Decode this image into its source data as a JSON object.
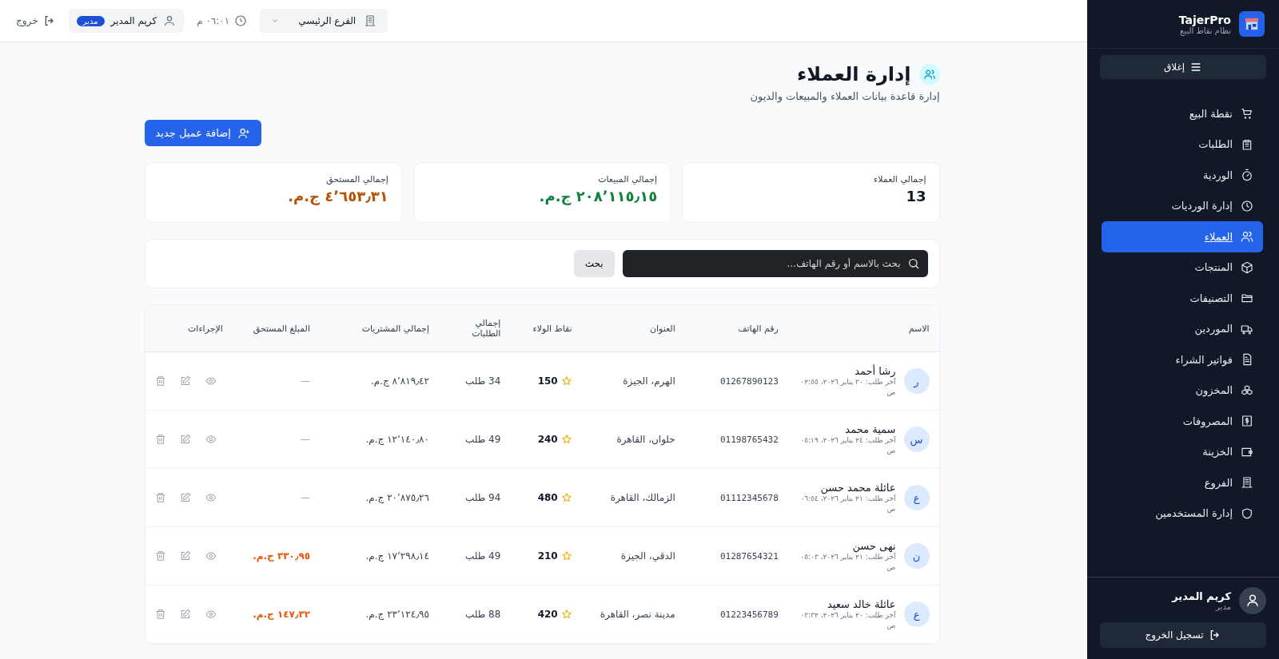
{
  "topbar": {
    "logout": "خروج",
    "user": {
      "name": "كريم المدير",
      "role": "مدير"
    },
    "time": "٠٦:٠١ م",
    "branch": "الفرع الرئيسي"
  },
  "sidebar": {
    "brand": "TajerPro",
    "tagline": "نظام نقاط البيع",
    "toggle": "إغلاق",
    "items": [
      {
        "label": "نقطة البيع",
        "selected": false
      },
      {
        "label": "الطلبات",
        "selected": false
      },
      {
        "label": "الوردية",
        "selected": false
      },
      {
        "label": "إدارة الورديات",
        "selected": false
      },
      {
        "label": "العملاء",
        "selected": true
      },
      {
        "label": "المنتجات",
        "selected": false
      },
      {
        "label": "التصنيفات",
        "selected": false
      },
      {
        "label": "الموردين",
        "selected": false
      },
      {
        "label": "فواتير الشراء",
        "selected": false
      },
      {
        "label": "المخزون",
        "selected": false
      },
      {
        "label": "المصروفات",
        "selected": false
      },
      {
        "label": "الخزينة",
        "selected": false
      },
      {
        "label": "الفروع",
        "selected": false
      },
      {
        "label": "إدارة المستخدمين",
        "selected": false
      }
    ],
    "user": {
      "name": "كريم المدير",
      "role": "مدير"
    },
    "signout": "تسجيل الخروج"
  },
  "page": {
    "title": "إدارة العملاء",
    "subtitle": "إدارة قاعدة بيانات العملاء والمبيعات والديون",
    "add_button": "إضافة عميل جديد"
  },
  "stats": [
    {
      "label": "إجمالي العملاء",
      "value": "13",
      "kind": "plain"
    },
    {
      "label": "إجمالي المبيعات",
      "value": "٢٠٨٬١١٥٫١٥ ج.م.",
      "kind": "positive"
    },
    {
      "label": "إجمالي المستحق",
      "value": "٤٬٦٥٣٫٣١ ج.م.",
      "kind": "warning"
    }
  ],
  "search": {
    "placeholder": "بحث بالاسم أو رقم الهاتف...",
    "button": "بحث"
  },
  "table": {
    "columns": [
      "الاسم",
      "رقم الهاتف",
      "العنوان",
      "نقاط الولاء",
      "إجمالي الطلبات",
      "إجمالي المشتريات",
      "المبلغ المستحق",
      "الإجراءات"
    ],
    "rows": [
      {
        "initial": "ر",
        "name": "رشا أحمد",
        "last_order": "آخر طلب: ٣٠ يناير ٢٠٢٦، ٠٢:٥٥ ص",
        "phone": "01267890123",
        "address": "الهرم، الجيزة",
        "points": "150",
        "orders": "34 طلب",
        "purchases": "٨٬٨١٩٫٤٢ ج.م.",
        "due": "—",
        "owing": false
      },
      {
        "initial": "س",
        "name": "سمية محمد",
        "last_order": "آخر طلب: ٢٤ يناير ٢٠٢٦، ٠٥:١٩ ص",
        "phone": "01198765432",
        "address": "حلوان، القاهرة",
        "points": "240",
        "orders": "49 طلب",
        "purchases": "١٢٬١٤٠٫٨٠ ج.م.",
        "due": "—",
        "owing": false
      },
      {
        "initial": "ع",
        "name": "عائلة محمد حسن",
        "last_order": "آخر طلب: ٢١ يناير ٢٠٢٦، ٠٦:٥٤ ص",
        "phone": "01112345678",
        "address": "الزمالك، القاهرة",
        "points": "480",
        "orders": "94 طلب",
        "purchases": "٢٠٬٨٧٥٫٢٦ ج.م.",
        "due": "—",
        "owing": false
      },
      {
        "initial": "ن",
        "name": "نهى حسن",
        "last_order": "آخر طلب: ٢١ يناير ٢٠٢٦، ٠٥:٠٣ ص",
        "phone": "01287654321",
        "address": "الدقي، الجيزة",
        "points": "210",
        "orders": "49 طلب",
        "purchases": "١٧٬٢٩٨٫١٤ ج.م.",
        "due": "٣٣٠٫٩٥ ج.م.",
        "owing": true
      },
      {
        "initial": "ع",
        "name": "عائلة خالد سعيد",
        "last_order": "آخر طلب: ٢٠ يناير ٢٠٢٦، ٠٣:٣٢ ص",
        "phone": "01223456789",
        "address": "مدينة نصر، القاهرة",
        "points": "420",
        "orders": "88 طلب",
        "purchases": "٢٣٬١٢٤٫٩٥ ج.م.",
        "due": "١٤٧٫٣٢ ج.م.",
        "owing": true
      }
    ]
  }
}
